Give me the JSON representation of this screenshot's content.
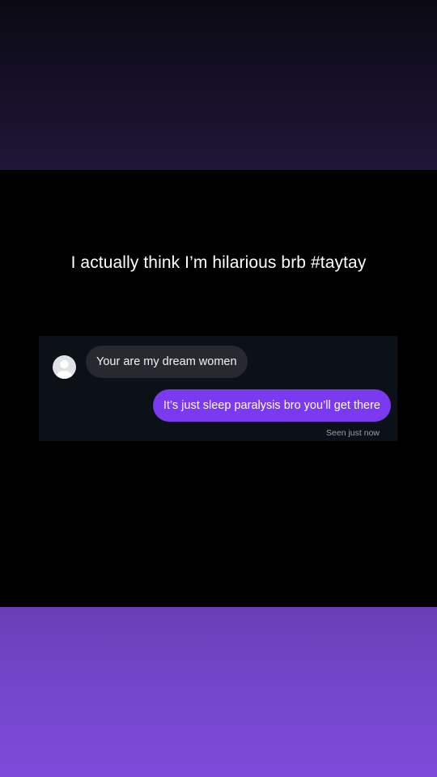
{
  "caption": "I actually think I’m hilarious brb #taytay",
  "chat": {
    "received": {
      "avatar_icon": "default-user-avatar",
      "text": "Your are my dream women"
    },
    "sent": {
      "text": "It’s just sleep paralysis bro you’ll get there",
      "color": "#7b3af0"
    },
    "status": "Seen just now"
  },
  "colors": {
    "top_band": "#1e1737",
    "bottom_band": "#7446cc",
    "background": "#000000",
    "chat_card": "#0c1117"
  }
}
